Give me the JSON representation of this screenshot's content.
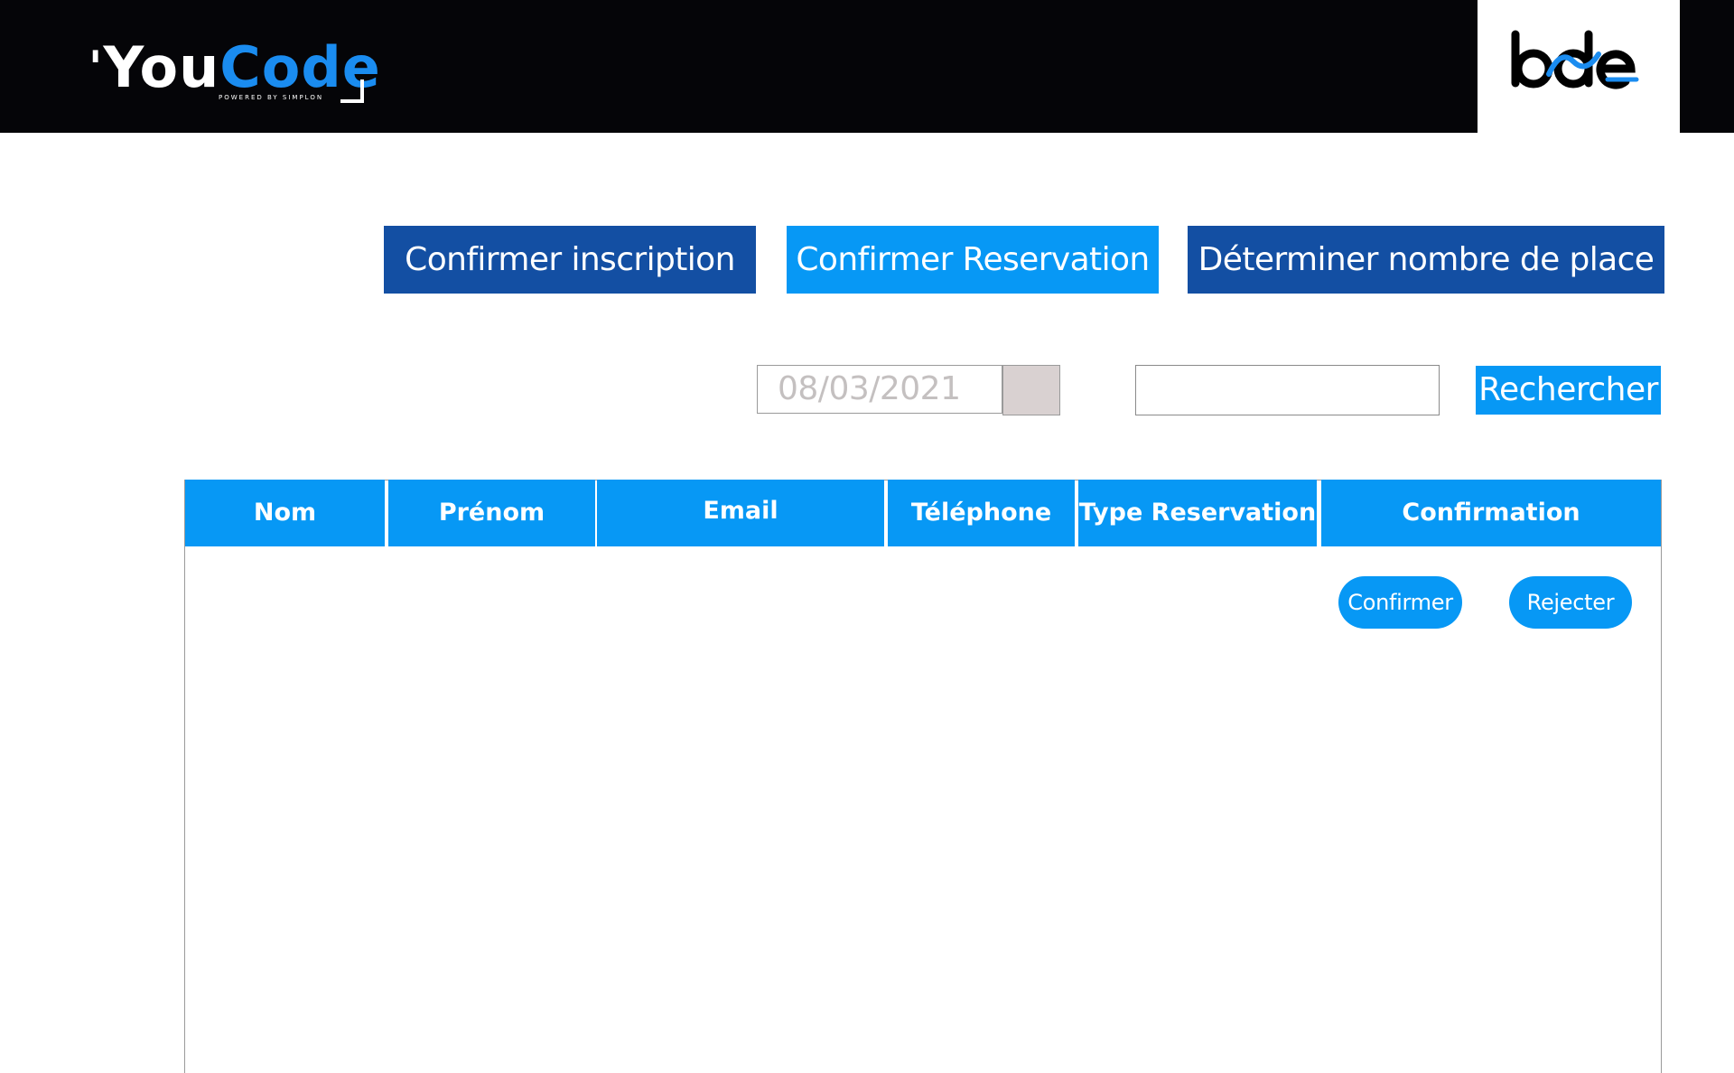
{
  "header": {
    "logo": {
      "quote": "'",
      "you": "You",
      "code": "Code",
      "tagline": "POWERED BY SIMPLON"
    },
    "partner_logo": "bde-logo"
  },
  "actions": {
    "confirm_registration": "Confirmer inscription",
    "confirm_reservation": "Confirmer Reservation",
    "set_places": "Déterminer nombre de place"
  },
  "search": {
    "date_value": "08/03/2021",
    "query_value": "",
    "button_label": "Rechercher"
  },
  "table": {
    "columns": [
      "Nom",
      "Prénom",
      "Email",
      "Téléphone",
      "Type Reservation",
      "Confirmation"
    ],
    "rows": [
      {
        "confirm_label": "Confirmer",
        "reject_label": "Rejecter"
      }
    ]
  },
  "colors": {
    "header_bg": "#050508",
    "accent_dark": "#134fa3",
    "accent_light": "#0798f5",
    "brand_blue": "#1a8cf0"
  }
}
